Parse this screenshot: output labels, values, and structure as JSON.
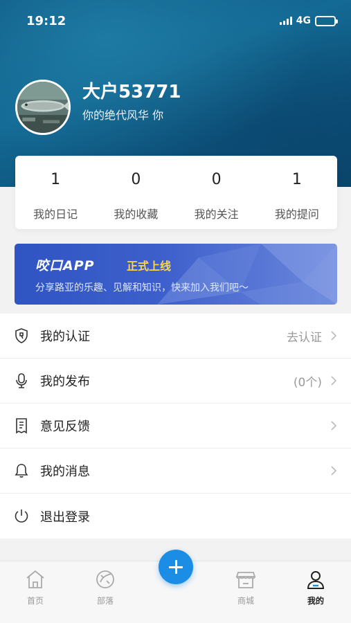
{
  "status_bar": {
    "time": "19:12",
    "network": "4G"
  },
  "profile": {
    "username": "大户53771",
    "bio": "你的绝代风华 你"
  },
  "stats": [
    {
      "value": "1",
      "label": "我的日记"
    },
    {
      "value": "0",
      "label": "我的收藏"
    },
    {
      "value": "0",
      "label": "我的关注"
    },
    {
      "value": "1",
      "label": "我的提问"
    }
  ],
  "banner": {
    "title": "咬口APP",
    "tag": "正式上线",
    "subtitle": "分享路亚的乐趣、见解和知识，快来加入我们吧～"
  },
  "menu": [
    {
      "label": "我的认证",
      "value": "去认证",
      "icon": "shield-icon"
    },
    {
      "label": "我的发布",
      "value": "(0个)",
      "icon": "microphone-icon"
    },
    {
      "label": "意见反馈",
      "value": "",
      "icon": "document-icon"
    },
    {
      "label": "我的消息",
      "value": "",
      "icon": "bell-icon"
    },
    {
      "label": "退出登录",
      "value": "",
      "icon": "power-icon"
    }
  ],
  "tabbar": [
    {
      "label": "首页",
      "icon": "home-icon"
    },
    {
      "label": "部落",
      "icon": "tribe-icon"
    },
    {
      "label": "商城",
      "icon": "store-icon"
    },
    {
      "label": "我的",
      "icon": "user-icon",
      "active": true
    }
  ],
  "colors": {
    "accent": "#1c8de4",
    "banner": "#3d5fcb",
    "banner_tag": "#ffd64a"
  }
}
